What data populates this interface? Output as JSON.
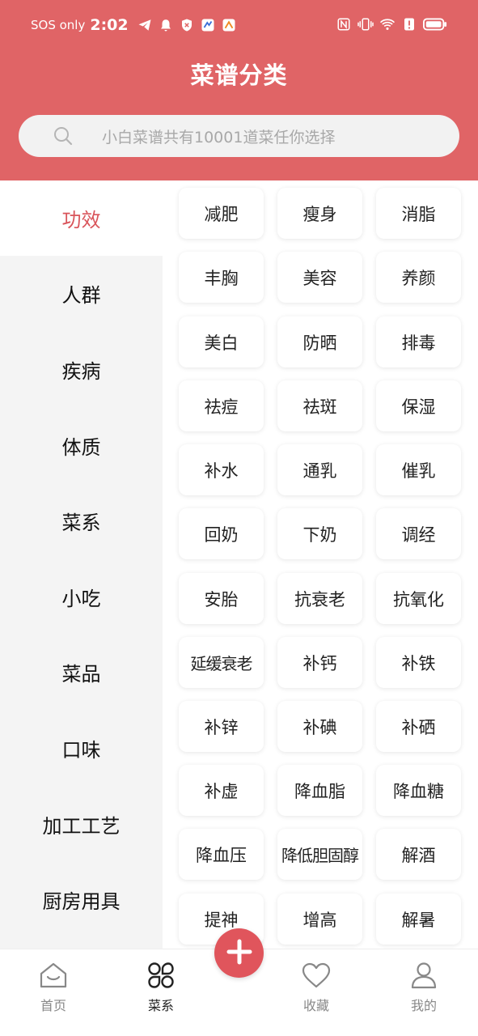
{
  "status": {
    "sos": "SOS only",
    "time": "2:02"
  },
  "page": {
    "title": "菜谱分类"
  },
  "search": {
    "placeholder": "小白菜谱共有10001道菜任你选择"
  },
  "sidebar": {
    "items": [
      {
        "label": "功效",
        "active": true
      },
      {
        "label": "人群"
      },
      {
        "label": "疾病"
      },
      {
        "label": "体质"
      },
      {
        "label": "菜系"
      },
      {
        "label": "小吃"
      },
      {
        "label": "菜品"
      },
      {
        "label": "口味"
      },
      {
        "label": "加工工艺"
      },
      {
        "label": "厨房用具"
      }
    ]
  },
  "grid": {
    "tags": [
      "减肥",
      "瘦身",
      "消脂",
      "丰胸",
      "美容",
      "养颜",
      "美白",
      "防晒",
      "排毒",
      "祛痘",
      "祛斑",
      "保湿",
      "补水",
      "通乳",
      "催乳",
      "回奶",
      "下奶",
      "调经",
      "安胎",
      "抗衰老",
      "抗氧化",
      "延缓衰老",
      "补钙",
      "补铁",
      "补锌",
      "补碘",
      "补硒",
      "补虚",
      "降血脂",
      "降血糖",
      "降血压",
      "降低胆固醇",
      "解酒",
      "提神",
      "增高",
      "解暑"
    ]
  },
  "tabbar": {
    "home": "首页",
    "recipes": "菜系",
    "favorites": "收藏",
    "mine": "我的"
  },
  "colors": {
    "brand": "#e06466",
    "accent": "#d9555b"
  }
}
